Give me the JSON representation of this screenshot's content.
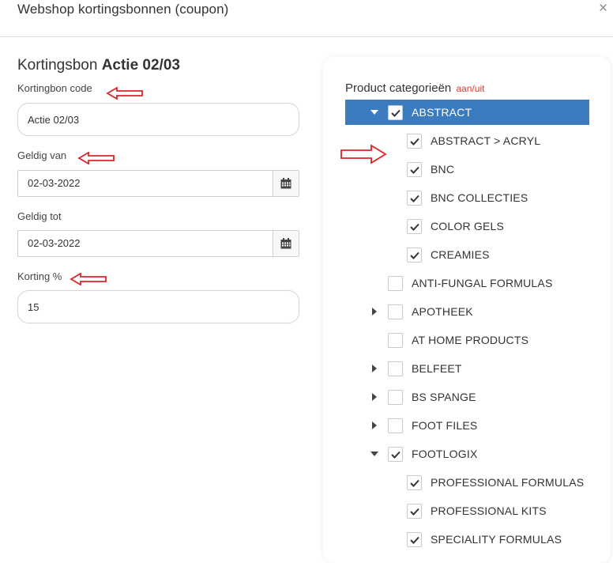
{
  "header": {
    "title": "Webshop kortingsbonnen (coupon)",
    "close_symbol": "×"
  },
  "form": {
    "heading_prefix": "Kortingsbon",
    "heading_name": "Actie 02/03",
    "code_label": "Kortingbon code",
    "code_value": "Actie 02/03",
    "valid_from_label": "Geldig van",
    "valid_from_value": "02-03-2022",
    "valid_to_label": "Geldig tot",
    "valid_to_value": "02-03-2022",
    "discount_label": "Korting %",
    "discount_value": "15"
  },
  "categories": {
    "title": "Product categorieën",
    "toggle_label": "aan/uit",
    "items": [
      {
        "label": "ABSTRACT",
        "checked": true,
        "caret": "down",
        "level": 0,
        "selected": true
      },
      {
        "label": "ABSTRACT > ACRYL",
        "checked": true,
        "caret": "none",
        "level": 1,
        "selected": false
      },
      {
        "label": "BNC",
        "checked": true,
        "caret": "none",
        "level": 1,
        "selected": false
      },
      {
        "label": "BNC COLLECTIES",
        "checked": true,
        "caret": "none",
        "level": 1,
        "selected": false
      },
      {
        "label": "COLOR GELS",
        "checked": true,
        "caret": "none",
        "level": 1,
        "selected": false
      },
      {
        "label": "CREAMIES",
        "checked": true,
        "caret": "none",
        "level": 1,
        "selected": false
      },
      {
        "label": "ANTI-FUNGAL FORMULAS",
        "checked": false,
        "caret": "none",
        "level": 0,
        "selected": false
      },
      {
        "label": "APOTHEEK",
        "checked": false,
        "caret": "right",
        "level": 0,
        "selected": false
      },
      {
        "label": "AT HOME PRODUCTS",
        "checked": false,
        "caret": "none",
        "level": 0,
        "selected": false
      },
      {
        "label": "BELFEET",
        "checked": false,
        "caret": "right",
        "level": 0,
        "selected": false
      },
      {
        "label": "BS SPANGE",
        "checked": false,
        "caret": "right",
        "level": 0,
        "selected": false
      },
      {
        "label": "FOOT FILES",
        "checked": false,
        "caret": "right",
        "level": 0,
        "selected": false
      },
      {
        "label": "FOOTLOGIX",
        "checked": true,
        "caret": "down",
        "level": 0,
        "selected": false
      },
      {
        "label": "PROFESSIONAL FORMULAS",
        "checked": true,
        "caret": "none",
        "level": 1,
        "selected": false
      },
      {
        "label": "PROFESSIONAL KITS",
        "checked": true,
        "caret": "none",
        "level": 1,
        "selected": false
      },
      {
        "label": "SPECIALITY FORMULAS",
        "checked": true,
        "caret": "none",
        "level": 1,
        "selected": false
      }
    ]
  },
  "colors": {
    "selected_row": "#3b7bbf",
    "annotation_arrow": "#d9262b",
    "toggle_text": "#e03c31"
  },
  "icons": {
    "close": "close-icon",
    "calendar": "calendar-icon",
    "check": "checkmark-icon",
    "caret_down": "caret-down-icon",
    "caret_right": "caret-right-icon",
    "annotation": "red-arrow-annotation"
  }
}
